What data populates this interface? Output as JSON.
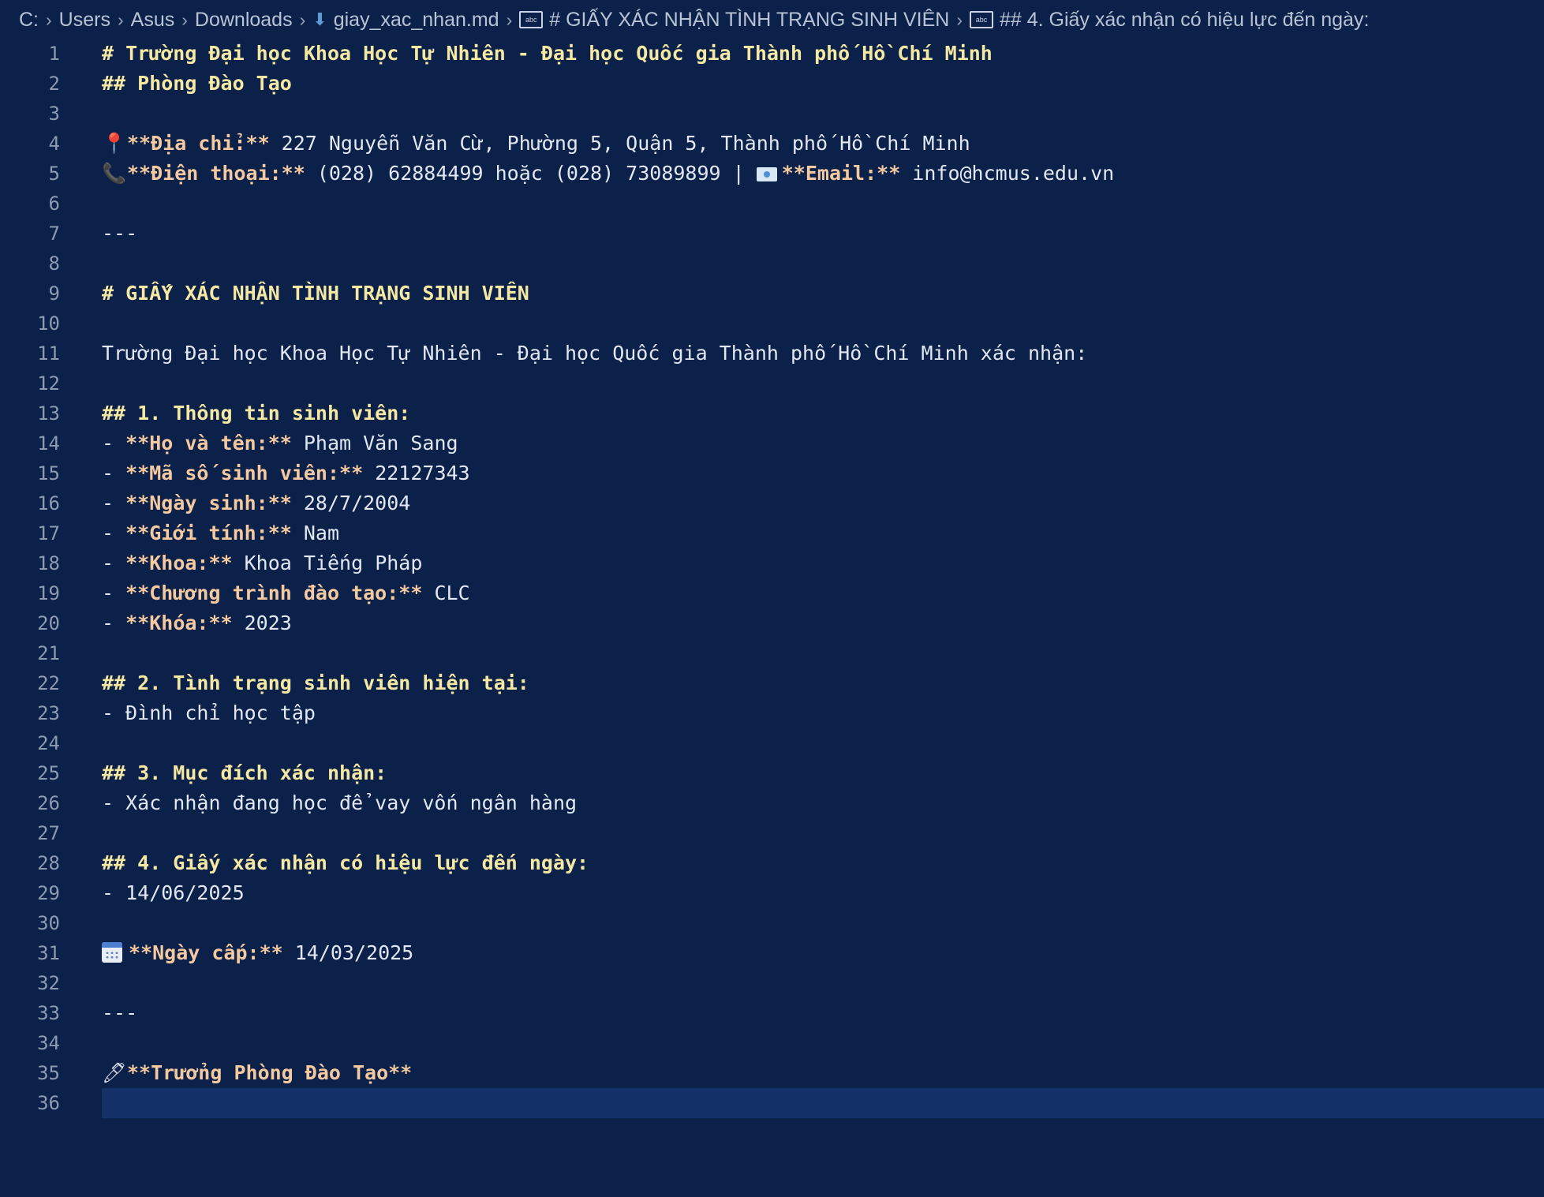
{
  "breadcrumb": {
    "drive": "C:",
    "users": "Users",
    "user": "Asus",
    "downloads": "Downloads",
    "file": "giay_xac_nhan.md",
    "section1": "# GIẤY XÁC NHẬN TÌNH TRẠNG SINH VIÊN",
    "section2": "## 4. Giấy xác nhận có hiệu lực đến ngày:"
  },
  "lines": {
    "l1": "# Trường Đại học Khoa Học Tự Nhiên - Đại học Quốc gia Thành phố Hồ Chí Minh",
    "l2": "## Phòng Đào Tạo",
    "l4_label": "**Địa chỉ:**",
    "l4_value": " 227 Nguyễn Văn Cừ, Phường 5, Quận 5, Thành phố Hồ Chí Minh",
    "l5_label": "**Điện thoại:**",
    "l5_value": " (028) 62884499 hoặc (028) 73089899 | ",
    "l5_email_label": "**Email:**",
    "l5_email_value": " info@hcmus.edu.vn",
    "l7": "---",
    "l9": "# GIẤY XÁC NHẬN TÌNH TRẠNG SINH VIÊN",
    "l11": "Trường Đại học Khoa Học Tự Nhiên - Đại học Quốc gia Thành phố Hồ Chí Minh xác nhận:",
    "l13": "## 1. Thông tin sinh viên:",
    "dash": "- ",
    "l14_label": "**Họ và tên:**",
    "l14_value": " Phạm Văn Sang",
    "l15_label": "**Mã số sinh viên:**",
    "l15_value": " 22127343",
    "l16_label": "**Ngày sinh:**",
    "l16_value": " 28/7/2004",
    "l17_label": "**Giới tính:**",
    "l17_value": " Nam",
    "l18_label": "**Khoa:**",
    "l18_value": " Khoa Tiếng Pháp",
    "l19_label": "**Chương trình đào tạo:**",
    "l19_value": " CLC",
    "l20_label": "**Khóa:**",
    "l20_value": " 2023",
    "l22": "## 2. Tình trạng sinh viên hiện tại:",
    "l23": "- Đình chỉ học tập",
    "l25": "## 3. Mục đích xác nhận:",
    "l26": "- Xác nhận đang học để vay vốn ngân hàng",
    "l28": "## 4. Giấy xác nhận có hiệu lực đến ngày:",
    "l29": "- 14/06/2025",
    "l31_label": "**Ngày cấp:**",
    "l31_value": " 14/03/2025",
    "l33": "---",
    "l35": "**Trưởng Phòng Đào Tạo**"
  },
  "line_numbers": [
    "1",
    "2",
    "3",
    "4",
    "5",
    "6",
    "7",
    "8",
    "9",
    "10",
    "11",
    "12",
    "13",
    "14",
    "15",
    "16",
    "17",
    "18",
    "19",
    "20",
    "21",
    "22",
    "23",
    "24",
    "25",
    "26",
    "27",
    "28",
    "29",
    "30",
    "31",
    "32",
    "33",
    "34",
    "35",
    "36"
  ]
}
